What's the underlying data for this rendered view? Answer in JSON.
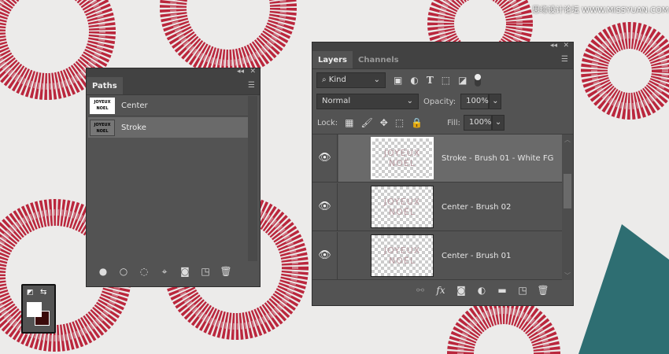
{
  "watermark": "思缘设计论坛 WWW.MISSYUAN.COM",
  "paths_panel": {
    "tab": "Paths",
    "items": [
      {
        "name": "Center",
        "thumb": "JOYEUX NOEL",
        "selected": false
      },
      {
        "name": "Stroke",
        "thumb": "JOYEUX NOEL",
        "selected": true
      }
    ],
    "toolbar": [
      "fill-path-icon",
      "stroke-path-icon",
      "load-selection-icon",
      "make-work-path-icon",
      "add-mask-icon",
      "new-path-icon",
      "delete-icon"
    ]
  },
  "layers_panel": {
    "tabs": [
      "Layers",
      "Channels"
    ],
    "filter_kind": "Kind",
    "blend_mode": "Normal",
    "opacity_label": "Opacity:",
    "opacity": "100%",
    "lock_label": "Lock:",
    "fill_label": "Fill:",
    "fill": "100%",
    "layers": [
      {
        "name": "Stroke - Brush 01 - White FG",
        "thumb_l1": "JOYEUX",
        "thumb_l2": "NOËL",
        "visible": true,
        "selected": true
      },
      {
        "name": "Center - Brush 02",
        "thumb_l1": "JOYEUX",
        "thumb_l2": "NOËL",
        "visible": true,
        "selected": false
      },
      {
        "name": "Center - Brush 01",
        "thumb_l1": "JOYEUX",
        "thumb_l2": "NOËL",
        "visible": true,
        "selected": false
      }
    ]
  },
  "colors": {
    "foreground": "#ffffff",
    "background": "#3a0a0a",
    "tinsel": "#b5122a"
  }
}
